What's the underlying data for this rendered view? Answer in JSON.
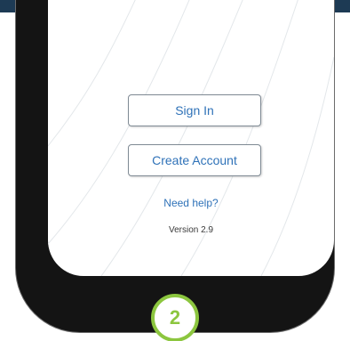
{
  "app": {
    "sign_in_label": "Sign In",
    "create_account_label": "Create Account",
    "help_link_label": "Need help?",
    "version_text": "Version 2.9"
  },
  "overlay": {
    "step_number": "2"
  },
  "colors": {
    "top_bar": "#1d3a54",
    "link_blue": "#2f72b8",
    "badge_green": "#8cc63f",
    "phone_frame": "#141414"
  }
}
